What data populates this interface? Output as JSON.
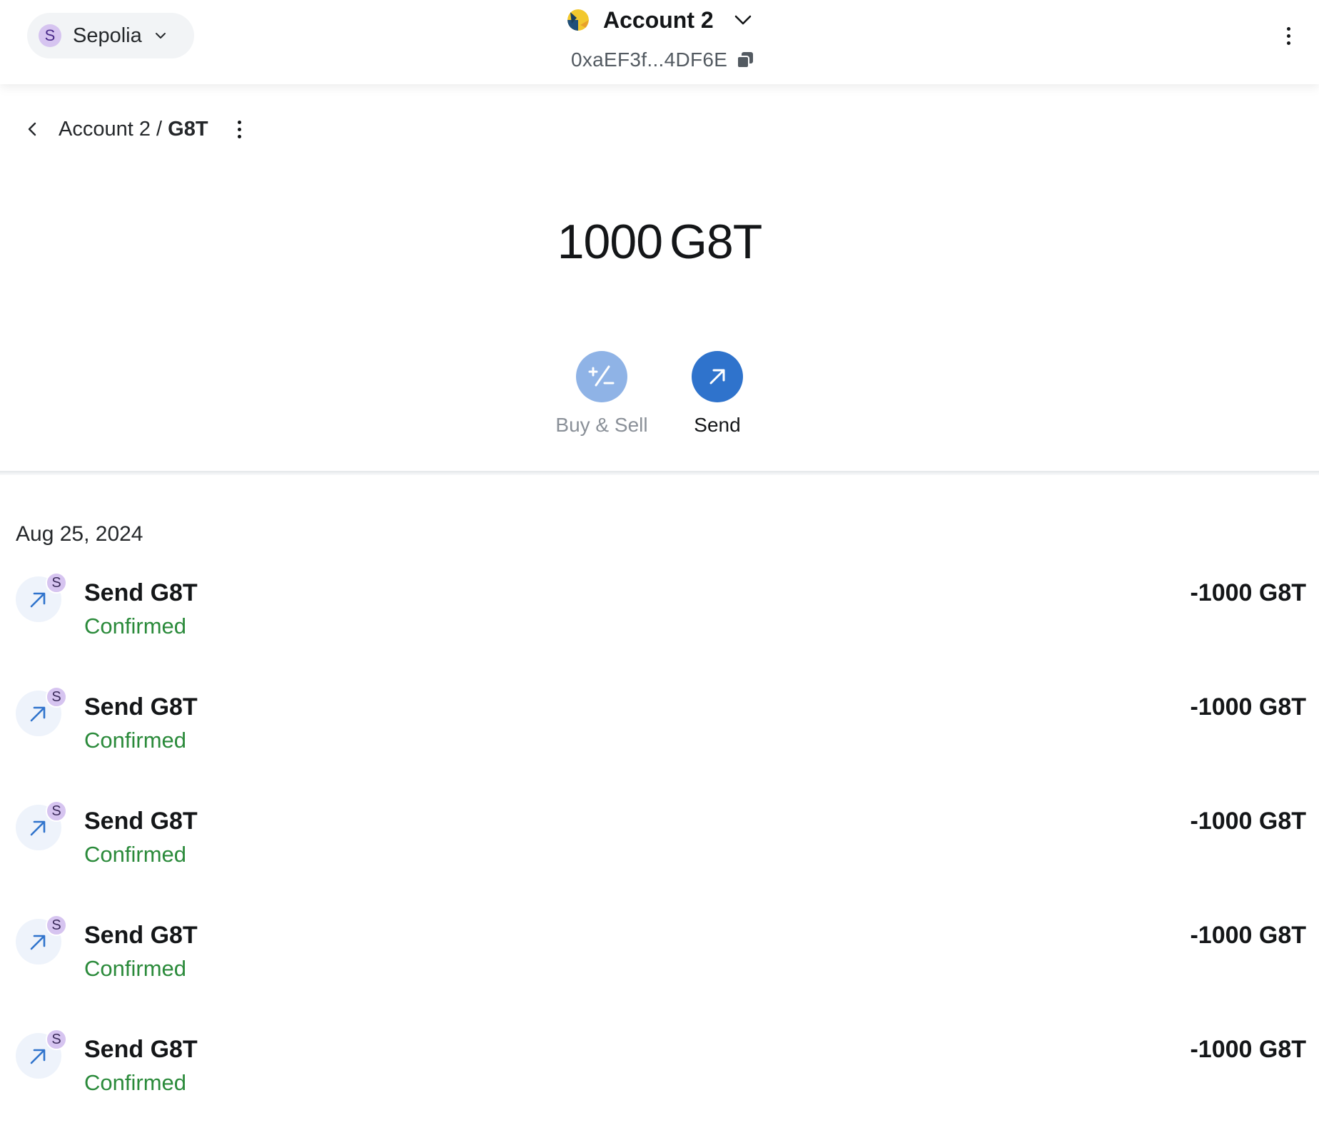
{
  "header": {
    "network": {
      "avatar_letter": "S",
      "label": "Sepolia"
    },
    "account": {
      "name": "Account 2",
      "address": "0xaEF3f...4DF6E"
    }
  },
  "breadcrumb": {
    "account": "Account 2",
    "separator": " / ",
    "token": "G8T"
  },
  "balance": {
    "amount": "1000",
    "unit": "G8T"
  },
  "actions": [
    {
      "label": "Buy & Sell",
      "enabled": false,
      "icon": "plus-minus-icon"
    },
    {
      "label": "Send",
      "enabled": true,
      "icon": "arrow-up-right-icon"
    }
  ],
  "activity": {
    "date": "Aug 25, 2024",
    "transactions": [
      {
        "title": "Send G8T",
        "status": "Confirmed",
        "amount": "-1000 G8T",
        "network_badge": "S"
      },
      {
        "title": "Send G8T",
        "status": "Confirmed",
        "amount": "-1000 G8T",
        "network_badge": "S"
      },
      {
        "title": "Send G8T",
        "status": "Confirmed",
        "amount": "-1000 G8T",
        "network_badge": "S"
      },
      {
        "title": "Send G8T",
        "status": "Confirmed",
        "amount": "-1000 G8T",
        "network_badge": "S"
      },
      {
        "title": "Send G8T",
        "status": "Confirmed",
        "amount": "-1000 G8T",
        "network_badge": "S"
      }
    ]
  },
  "colors": {
    "primary": "#2f73cc",
    "primary_disabled": "#8fb3e6",
    "success": "#2a8a3a",
    "network_avatar": "#d6c4f0"
  }
}
